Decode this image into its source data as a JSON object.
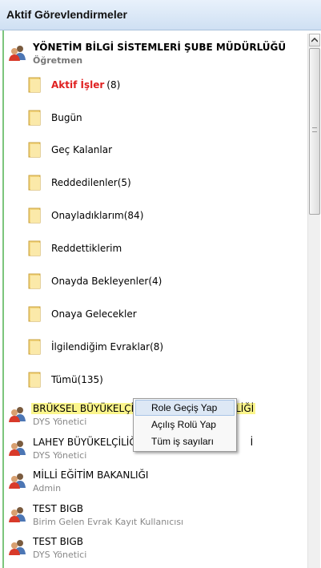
{
  "header": {
    "title": "Aktif Görevlendirmeler"
  },
  "main_unit": {
    "name": "YÖNETİM BİLGİ SİSTEMLERİ ŞUBE MÜDÜRLÜĞÜ",
    "role": "Öğretmen",
    "folders": [
      {
        "label": "Aktif İşler",
        "count": "(8)",
        "active": true
      },
      {
        "label": "Bugün"
      },
      {
        "label": "Geç Kalanlar"
      },
      {
        "label": "Reddedilenler(5)"
      },
      {
        "label": "Onayladıklarım(84)"
      },
      {
        "label": "Reddettiklerim"
      },
      {
        "label": "Onayda Bekleyenler(4)"
      },
      {
        "label": "Onaya Gelecekler"
      },
      {
        "label": "İlgilendiğim Evraklar(8)"
      },
      {
        "label": "Tümü(135)"
      }
    ]
  },
  "units": [
    {
      "name_left": "BRÜKSEL BÜYÜKELÇİ",
      "name_right": "LİĞİ",
      "role": "DYS Yönetici"
    },
    {
      "name_left": "LAHEY BÜYÜKELÇİLİĞ",
      "name_right": "İ",
      "role": "DYS Yönetici"
    },
    {
      "name": "MİLLİ EĞİTİM BAKANLIĞI",
      "role": "Admin"
    },
    {
      "name": "TEST BIGB",
      "role": "Birim Gelen Evrak Kayıt Kullanıcısı"
    },
    {
      "name": "TEST BIGB",
      "role": "DYS Yönetici"
    }
  ],
  "context_menu": {
    "items": [
      "Role Geçiş Yap",
      "Açılış Rolü Yap",
      "Tüm iş sayıları"
    ]
  },
  "colors": {
    "active_folder": "#e02020",
    "highlight": "#fbf58c",
    "header_bg": "#cfe0f3",
    "green_border": "#7cc57c"
  },
  "icons": {
    "unit": "users-icon",
    "folder": "folder-icon",
    "scroll_up": "chevron-up-icon"
  }
}
